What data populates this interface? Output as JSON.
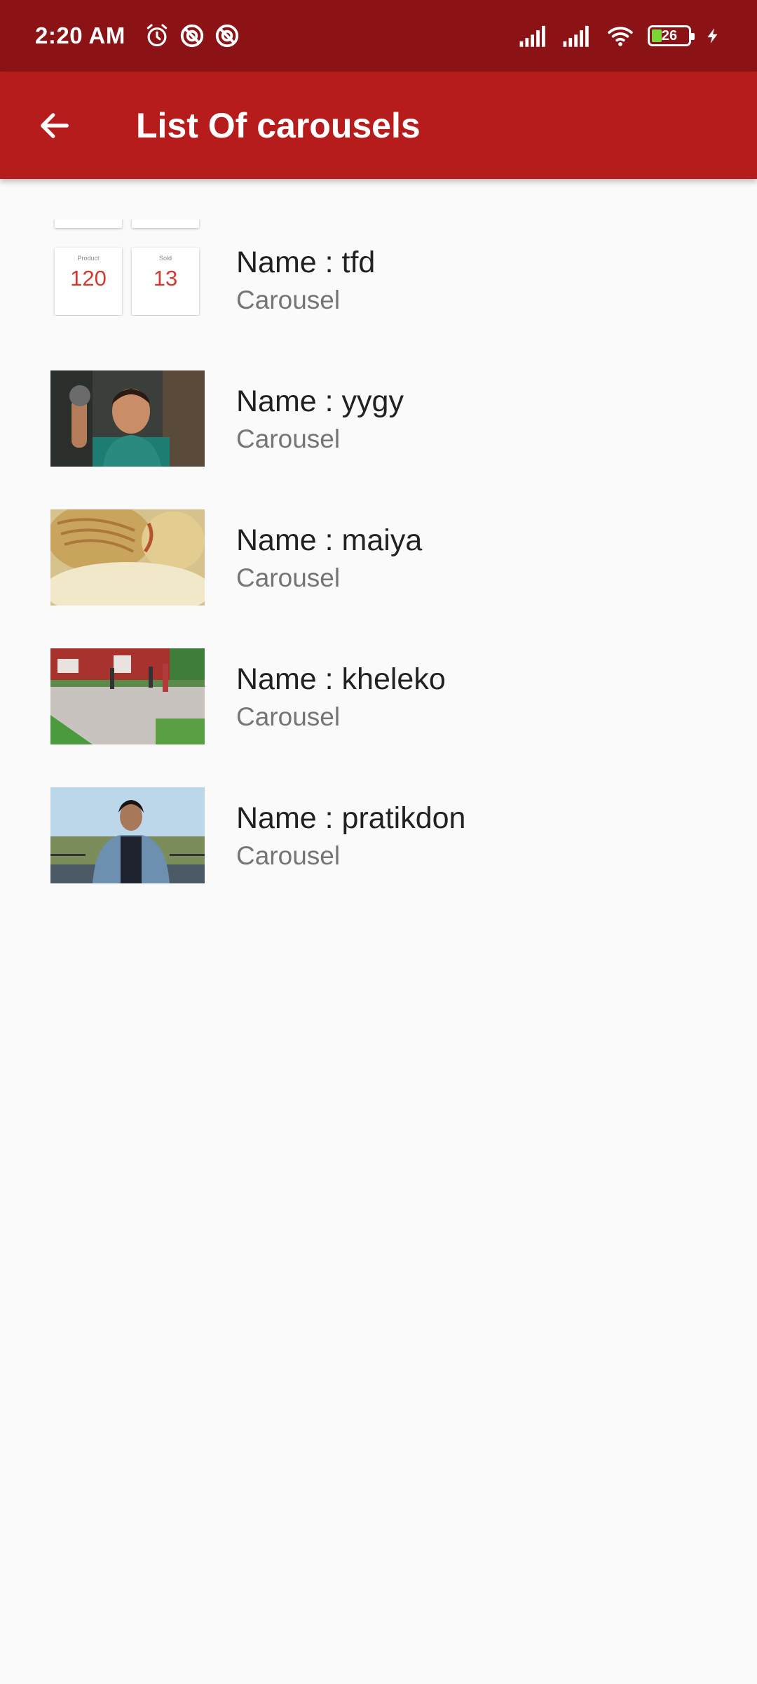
{
  "status_bar": {
    "time": "2:20 AM",
    "battery_level": "26",
    "icons": [
      "alarm-icon",
      "data-saver-icon",
      "data-saver-icon",
      "signal-icon",
      "signal-icon",
      "wifi-icon",
      "battery-icon",
      "charging-icon"
    ]
  },
  "app_bar": {
    "title": "List Of carousels",
    "back_icon": "arrow-back-icon"
  },
  "colors": {
    "status_bar": "#8b1315",
    "app_bar": "#b71c1c",
    "background": "#fafafa",
    "stat_value": "#d03b30"
  },
  "carousels": [
    {
      "name": "Name : tfd",
      "type": "Carousel",
      "thumb_stats": [
        {
          "label": "Product",
          "value": "120"
        },
        {
          "label": "Sold",
          "value": "13"
        }
      ]
    },
    {
      "name": "Name : yygy",
      "type": "Carousel"
    },
    {
      "name": "Name : maiya",
      "type": "Carousel"
    },
    {
      "name": "Name : kheleko",
      "type": "Carousel"
    },
    {
      "name": "Name : pratikdon",
      "type": "Carousel"
    }
  ]
}
